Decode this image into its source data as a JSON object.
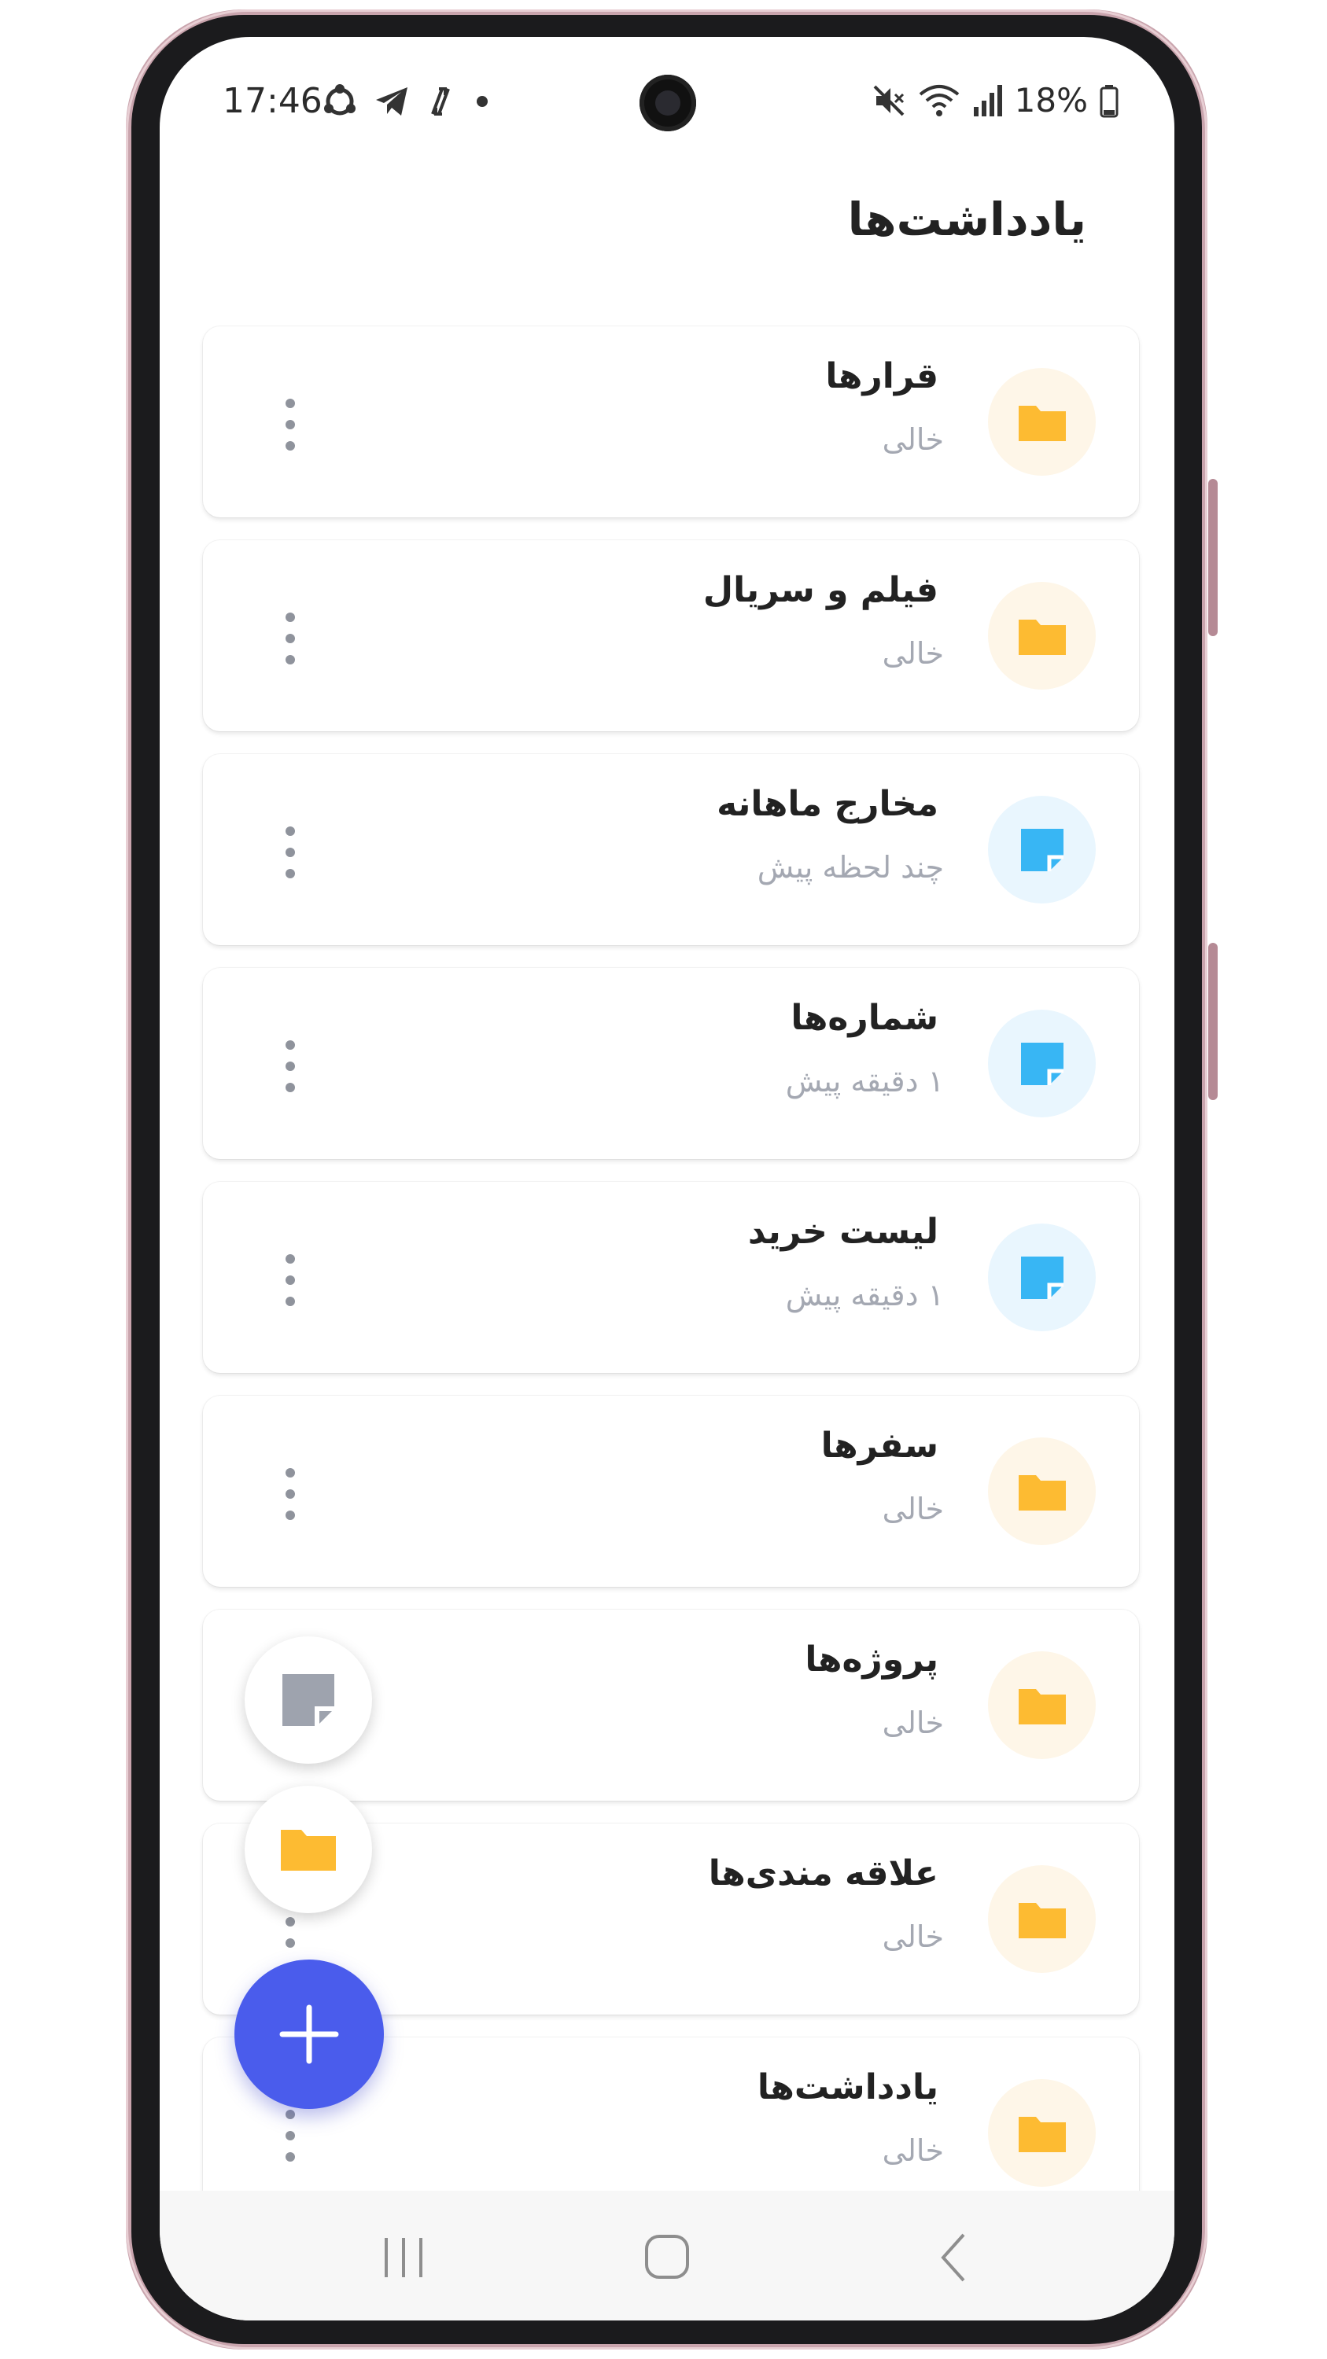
{
  "status_bar": {
    "time": "17:46",
    "battery": "18%",
    "icons_left": [
      "sync-icon",
      "telegram-icon",
      "transfer-icon",
      "dot-icon"
    ],
    "icons_right": [
      "mute-icon",
      "wifi-icon",
      "signal-icon",
      "battery-icon"
    ]
  },
  "header": {
    "title": "یادداشت‌ها"
  },
  "items": [
    {
      "title": "قرارها",
      "subtitle": "خالی",
      "type": "folder"
    },
    {
      "title": "فیلم و سریال",
      "subtitle": "خالی",
      "type": "folder"
    },
    {
      "title": "مخارج ماهانه",
      "subtitle": "چند لحظه پیش",
      "type": "note"
    },
    {
      "title": "شماره‌ها",
      "subtitle": "۱ دقیقه پیش",
      "type": "note"
    },
    {
      "title": "لیست خرید",
      "subtitle": "۱ دقیقه پیش",
      "type": "note"
    },
    {
      "title": "سفرها",
      "subtitle": "خالی",
      "type": "folder"
    },
    {
      "title": "پروژه‌ها",
      "subtitle": "خالی",
      "type": "folder"
    },
    {
      "title": "علاقه مندی‌ها",
      "subtitle": "خالی",
      "type": "folder"
    },
    {
      "title": "یادداشت‌ها",
      "subtitle": "خالی",
      "type": "folder"
    }
  ],
  "colors": {
    "folder": "#fdbb32",
    "folder_bg": "#fef6e8",
    "note": "#38b6f4",
    "note_bg": "#e9f6fe",
    "fab": "#4a5cec",
    "mini_note": "#9ea3ae"
  },
  "fab": {
    "icon": "plus-icon",
    "mini_actions": [
      "new-note-icon",
      "new-folder-icon"
    ]
  },
  "navbar": {
    "icons": [
      "recent-apps-icon",
      "home-icon",
      "back-icon"
    ]
  }
}
